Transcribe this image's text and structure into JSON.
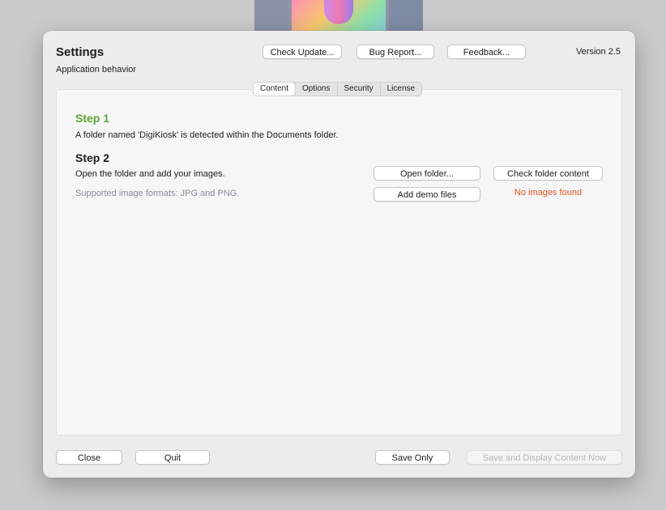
{
  "dialog": {
    "title": "Settings",
    "subtitle": "Application behavior",
    "version": "Version 2.5"
  },
  "header_buttons": {
    "check_update": "Check Update...",
    "bug_report": "Bug Report...",
    "feedback": "Feedback..."
  },
  "tabs": [
    {
      "label": "Content",
      "active": true
    },
    {
      "label": "Options",
      "active": false
    },
    {
      "label": "Security",
      "active": false
    },
    {
      "label": "License",
      "active": false
    }
  ],
  "content": {
    "step1": {
      "heading": "Step 1",
      "text": "A folder named 'DigiKiosk' is detected within the Documents folder."
    },
    "step2": {
      "heading": "Step 2",
      "text": "Open the folder and add your images.",
      "formats": "Supported image formats: JPG and PNG.",
      "open_folder": "Open folder...",
      "check_folder": "Check folder content",
      "add_demo": "Add demo files",
      "status": "No images found"
    }
  },
  "footer": {
    "close": "Close",
    "quit": "Quit",
    "save_only": "Save Only",
    "save_display": "Save and Display Content Now"
  },
  "colors": {
    "step1_accent": "#5aa832",
    "status_warning": "#e8541c"
  }
}
